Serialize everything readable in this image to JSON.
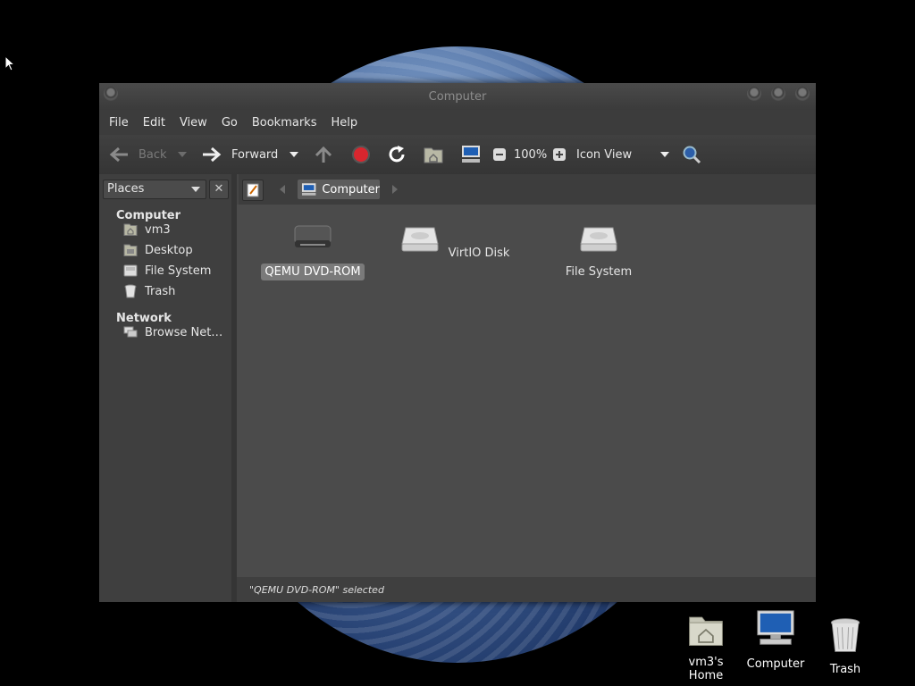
{
  "window": {
    "title": "Computer"
  },
  "menubar": [
    "File",
    "Edit",
    "View",
    "Go",
    "Bookmarks",
    "Help"
  ],
  "toolbar": {
    "back_label": "Back",
    "forward_label": "Forward",
    "zoom": "100%",
    "view_mode": "Icon View"
  },
  "sidebar": {
    "selector": "Places",
    "close": "✕",
    "sections": [
      {
        "heading": "Computer",
        "items": [
          "vm3",
          "Desktop",
          "File System",
          "Trash"
        ]
      },
      {
        "heading": "Network",
        "items": [
          "Browse Net…"
        ]
      }
    ]
  },
  "location": {
    "crumb": "Computer"
  },
  "files": [
    {
      "name": "QEMU DVD-ROM",
      "icon": "optical-drive-icon",
      "selected": true
    },
    {
      "name": "VirtIO Disk",
      "icon": "hard-disk-icon",
      "selected": false
    },
    {
      "name": "File System",
      "icon": "hard-disk-icon",
      "selected": false
    }
  ],
  "statusbar": {
    "text": "\"QEMU DVD-ROM\" selected"
  },
  "desktop_icons": [
    {
      "label": "vm3's Home",
      "icon": "home-folder-icon"
    },
    {
      "label": "Computer",
      "icon": "computer-icon"
    },
    {
      "label": "Trash",
      "icon": "trash-icon"
    }
  ],
  "colors": {
    "accent": "#7a7a7a",
    "window_bg": "#454545",
    "content_bg": "#4b4b4b",
    "stop": "#d9262e"
  }
}
